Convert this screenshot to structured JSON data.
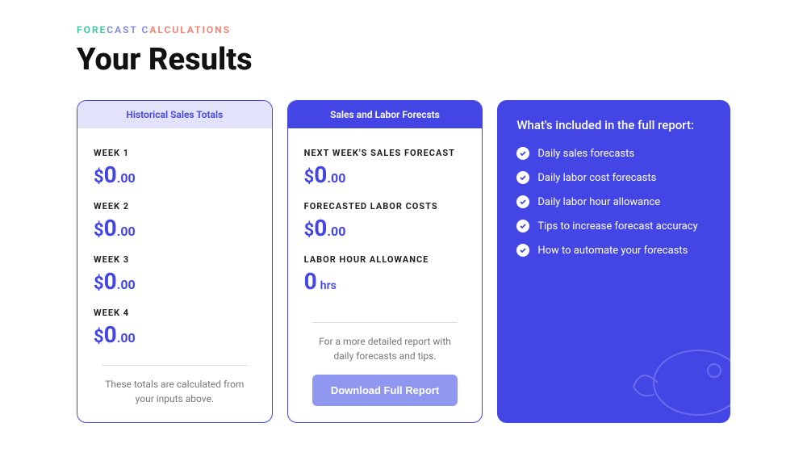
{
  "eyebrow": {
    "p1": "FORE",
    "p2": "CAST C",
    "p3": "ALCULATIONS"
  },
  "title": "Your Results",
  "historical": {
    "header": "Historical Sales Totals",
    "weeks": [
      {
        "label": "WEEK 1",
        "dollar": "$",
        "big": "0",
        "cents": ".00"
      },
      {
        "label": "WEEK 2",
        "dollar": "$",
        "big": "0",
        "cents": ".00"
      },
      {
        "label": "WEEK 3",
        "dollar": "$",
        "big": "0",
        "cents": ".00"
      },
      {
        "label": "WEEK 4",
        "dollar": "$",
        "big": "0",
        "cents": ".00"
      }
    ],
    "note": "These totals are calculated from your inputs above."
  },
  "forecast": {
    "header": "Sales and Labor Forecsts",
    "items": [
      {
        "label": "NEXT WEEK'S SALES FORECAST",
        "dollar": "$",
        "big": "0",
        "cents": ".00",
        "unit": ""
      },
      {
        "label": "FORECASTED LABOR COSTS",
        "dollar": "$",
        "big": "0",
        "cents": ".00",
        "unit": ""
      },
      {
        "label": "LABOR HOUR ALLOWANCE",
        "dollar": "",
        "big": "0",
        "cents": "",
        "unit": "hrs"
      }
    ],
    "note": "For a more detailed report with daily forecasts and tips.",
    "button": "Download Full Report"
  },
  "report": {
    "title": "What's included in the full report:",
    "items": [
      "Daily sales forecasts",
      "Daily labor cost forecasts",
      "Daily labor hour allowance",
      "Tips to increase forecast accuracy",
      "How to automate your forecasts"
    ]
  }
}
